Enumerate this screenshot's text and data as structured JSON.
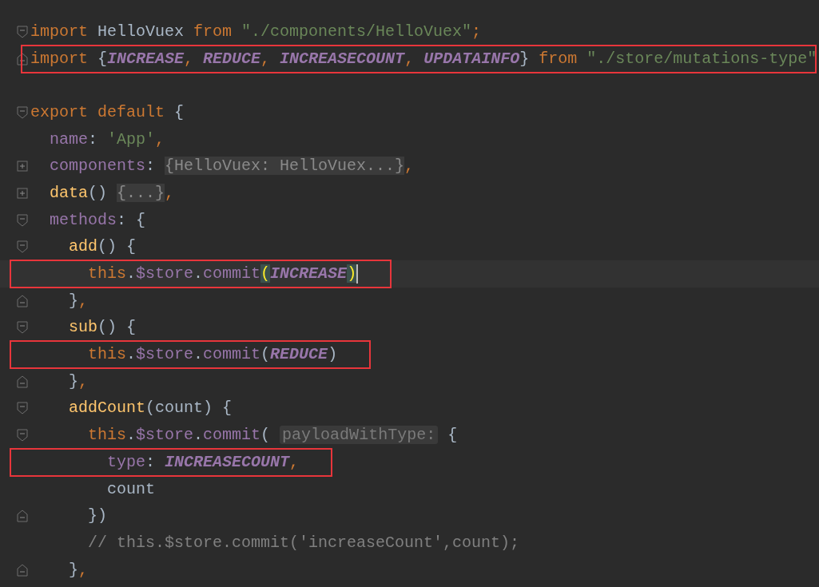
{
  "editor": {
    "lines": [
      {
        "kind": "fold-start",
        "boxed": false,
        "tokens": [
          {
            "kind": "kw",
            "text": "import "
          },
          {
            "kind": "plain",
            "text": "HelloVuex "
          },
          {
            "kind": "kw",
            "text": "from "
          },
          {
            "kind": "str",
            "text": "\"./components/HelloVuex\""
          },
          {
            "kind": "kw",
            "text": ";"
          }
        ]
      },
      {
        "kind": "fold-end",
        "boxed": true,
        "wide": true,
        "tokens": [
          {
            "kind": "kw",
            "text": "import "
          },
          {
            "kind": "plain",
            "text": "{"
          },
          {
            "kind": "const",
            "text": "INCREASE"
          },
          {
            "kind": "kw",
            "text": ", "
          },
          {
            "kind": "const",
            "text": "REDUCE"
          },
          {
            "kind": "kw",
            "text": ", "
          },
          {
            "kind": "const",
            "text": "INCREASECOUNT"
          },
          {
            "kind": "kw",
            "text": ", "
          },
          {
            "kind": "const",
            "text": "UPDATAINFO"
          },
          {
            "kind": "plain",
            "text": "} "
          },
          {
            "kind": "kw",
            "text": "from "
          },
          {
            "kind": "str",
            "text": "\"./store/mutations-type\""
          }
        ]
      },
      {
        "kind": "plain",
        "boxed": false
      },
      {
        "kind": "fold-start",
        "boxed": false,
        "tokens": [
          {
            "kind": "kw",
            "text": "export default "
          },
          {
            "kind": "plain",
            "text": "{"
          }
        ]
      },
      {
        "kind": "plain",
        "boxed": false,
        "tokens": [
          {
            "kind": "prop",
            "text": "  name"
          },
          {
            "kind": "plain",
            "text": ": "
          },
          {
            "kind": "str",
            "text": "'App'"
          },
          {
            "kind": "kw",
            "text": ","
          }
        ]
      },
      {
        "kind": "collapsed",
        "boxed": false,
        "tokens": [
          {
            "kind": "prop",
            "text": "  components"
          },
          {
            "kind": "plain",
            "text": ": "
          },
          {
            "kind": "folded",
            "text": "{HelloVuex: HelloVuex...}"
          },
          {
            "kind": "kw",
            "text": ","
          }
        ]
      },
      {
        "kind": "collapsed",
        "boxed": false,
        "tokens": [
          {
            "kind": "fn",
            "text": "  data"
          },
          {
            "kind": "plain",
            "text": "() "
          },
          {
            "kind": "folded",
            "text": "{...}"
          },
          {
            "kind": "kw",
            "text": ","
          }
        ]
      },
      {
        "kind": "fold-start",
        "boxed": false,
        "tokens": [
          {
            "kind": "prop",
            "text": "  methods"
          },
          {
            "kind": "plain",
            "text": ": {"
          }
        ]
      },
      {
        "kind": "fold-start",
        "boxed": false,
        "tokens": [
          {
            "kind": "fn",
            "text": "    add"
          },
          {
            "kind": "plain",
            "text": "() {"
          }
        ]
      },
      {
        "kind": "plain",
        "current": true,
        "boxed": true,
        "wide": false,
        "caret": true,
        "tokens": [
          {
            "kind": "kw",
            "text": "      this"
          },
          {
            "kind": "plain",
            "text": "."
          },
          {
            "kind": "prop",
            "text": "$store"
          },
          {
            "kind": "plain",
            "text": "."
          },
          {
            "kind": "prop",
            "text": "commit"
          },
          {
            "kind": "match",
            "text": "("
          },
          {
            "kind": "const",
            "text": "INCREASE"
          },
          {
            "kind": "match",
            "text": ")"
          }
        ]
      },
      {
        "kind": "fold-end",
        "boxed": false,
        "tokens": [
          {
            "kind": "plain",
            "text": "    }"
          },
          {
            "kind": "kw",
            "text": ","
          }
        ]
      },
      {
        "kind": "fold-start",
        "boxed": false,
        "tokens": [
          {
            "kind": "fn",
            "text": "    sub"
          },
          {
            "kind": "plain",
            "text": "() {"
          }
        ]
      },
      {
        "kind": "plain",
        "boxed": true,
        "wide": false,
        "tokens": [
          {
            "kind": "kw",
            "text": "      this"
          },
          {
            "kind": "plain",
            "text": "."
          },
          {
            "kind": "prop",
            "text": "$store"
          },
          {
            "kind": "plain",
            "text": "."
          },
          {
            "kind": "prop",
            "text": "commit"
          },
          {
            "kind": "plain",
            "text": "("
          },
          {
            "kind": "const",
            "text": "REDUCE"
          },
          {
            "kind": "plain",
            "text": ")"
          }
        ]
      },
      {
        "kind": "fold-end",
        "boxed": false,
        "tokens": [
          {
            "kind": "plain",
            "text": "    }"
          },
          {
            "kind": "kw",
            "text": ","
          }
        ]
      },
      {
        "kind": "fold-start",
        "boxed": false,
        "tokens": [
          {
            "kind": "fn",
            "text": "    addCount"
          },
          {
            "kind": "plain",
            "text": "(count) {"
          }
        ]
      },
      {
        "kind": "fold-start",
        "boxed": false,
        "tokens": [
          {
            "kind": "kw",
            "text": "      this"
          },
          {
            "kind": "plain",
            "text": "."
          },
          {
            "kind": "prop",
            "text": "$store"
          },
          {
            "kind": "plain",
            "text": "."
          },
          {
            "kind": "prop",
            "text": "commit"
          },
          {
            "kind": "plain",
            "text": "( "
          },
          {
            "kind": "hint",
            "text": "payloadWithType:"
          },
          {
            "kind": "plain",
            "text": " {"
          }
        ]
      },
      {
        "kind": "plain",
        "boxed": true,
        "wide": false,
        "tokens": [
          {
            "kind": "prop",
            "text": "        type"
          },
          {
            "kind": "plain",
            "text": ": "
          },
          {
            "kind": "const",
            "text": "INCREASECOUNT"
          },
          {
            "kind": "kw",
            "text": ","
          }
        ]
      },
      {
        "kind": "plain",
        "boxed": false,
        "tokens": [
          {
            "kind": "plain",
            "text": "        count"
          }
        ]
      },
      {
        "kind": "fold-end",
        "boxed": false,
        "tokens": [
          {
            "kind": "plain",
            "text": "      })"
          }
        ]
      },
      {
        "kind": "plain",
        "boxed": false,
        "tokens": [
          {
            "kind": "comment",
            "text": "      // this.$store.commit('increaseCount',count);"
          }
        ]
      },
      {
        "kind": "fold-end",
        "boxed": false,
        "tokens": [
          {
            "kind": "plain",
            "text": "    }"
          },
          {
            "kind": "kw",
            "text": ","
          }
        ]
      }
    ]
  }
}
